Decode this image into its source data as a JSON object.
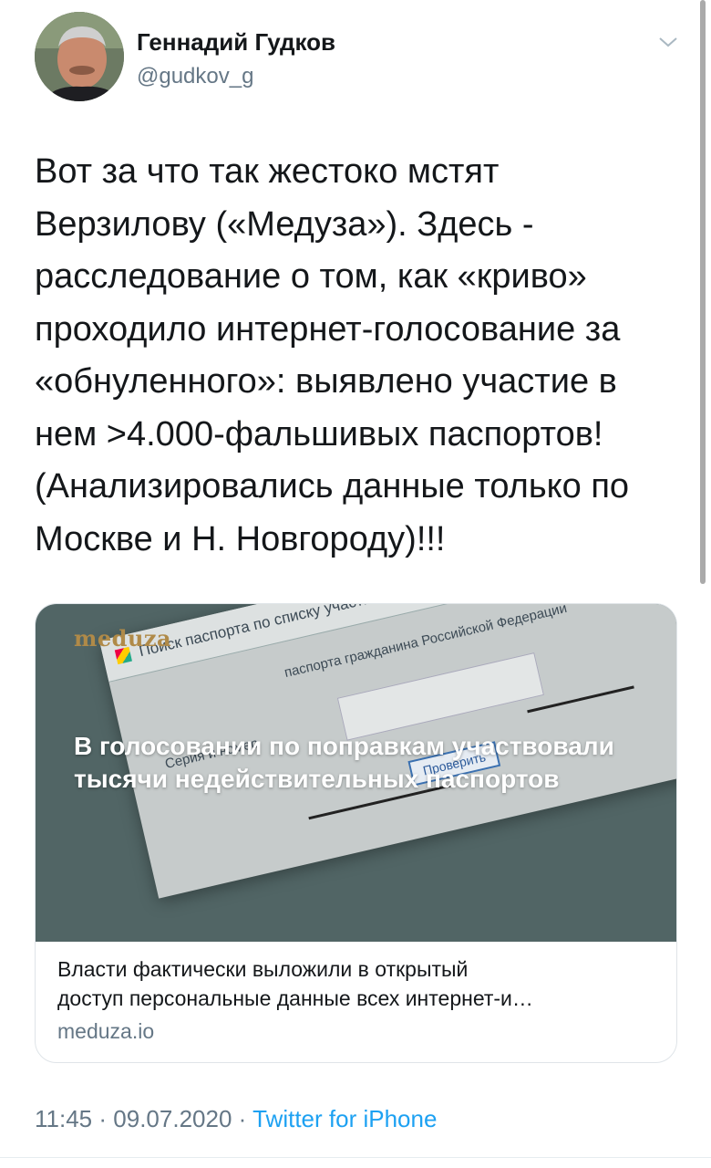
{
  "author": {
    "name": "Геннадий Гудков",
    "handle": "@gudkov_g"
  },
  "tweet": {
    "text": "Вот за что так жестоко мстят\nВерзилову («Медуза»). Здесь -\nрасследование о том, как «криво»\nпроходило интернет-голосование за\n«обнуленного»: выявлено участие в\nнем >4.000-фальшивых паспортов!\n(Анализировались данные только по\nМоскве и Н. Новгороду)!!!"
  },
  "card": {
    "logo": "meduza",
    "headline": "В голосовании по поправкам участвовали тысячи недействительных паспортов",
    "image_text": {
      "window_title": "Поиск паспорта по списку участн...",
      "heading": "паспорта гражданина Российской Федерации",
      "field_label": "Серия и номер",
      "button": "Проверить"
    },
    "description_line1": "Власти фактически выложили в открытый",
    "description_line2": "доступ персональные данные всех интернет-и…",
    "domain": "meduza.io"
  },
  "meta": {
    "time": "11:45",
    "separator": "·",
    "date": "09.07.2020",
    "source": "Twitter for iPhone"
  },
  "colors": {
    "link": "#1da1f2",
    "secondary": "#657786",
    "card_bg": "#516565",
    "logo": "#b08a48"
  }
}
